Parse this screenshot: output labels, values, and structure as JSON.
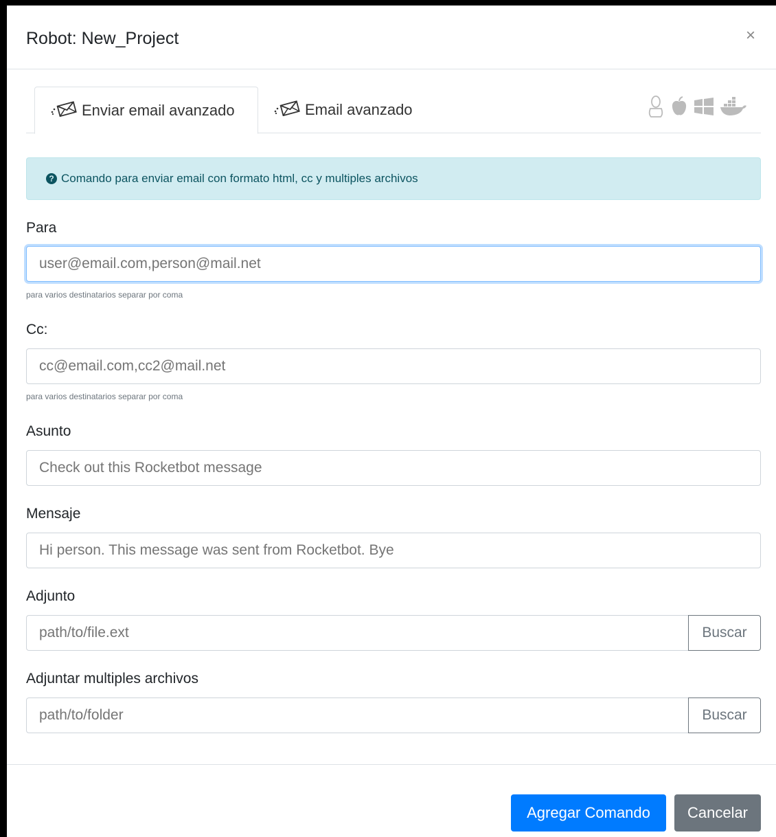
{
  "header": {
    "title": "Robot: New_Project",
    "close_symbol": "×"
  },
  "tabs": [
    {
      "label": "Enviar email avanzado",
      "icon": "envelope-icon",
      "active": true
    },
    {
      "label": "Email avanzado",
      "icon": "envelope-icon",
      "active": false
    }
  ],
  "os_icons": [
    "linux-icon",
    "apple-icon",
    "windows-icon",
    "docker-icon"
  ],
  "alert": {
    "text": "Comando para enviar email con formato html, cc y multiples archivos"
  },
  "fields": {
    "para": {
      "label": "Para",
      "placeholder": "user@email.com,person@mail.net",
      "help": "para varios destinatarios separar por coma"
    },
    "cc": {
      "label": "Cc:",
      "placeholder": "cc@email.com,cc2@mail.net",
      "help": "para varios destinatarios separar por coma"
    },
    "asunto": {
      "label": "Asunto",
      "placeholder": "Check out this Rocketbot message"
    },
    "mensaje": {
      "label": "Mensaje",
      "placeholder": "Hi person. This message was sent from Rocketbot. Bye"
    },
    "adjunto": {
      "label": "Adjunto",
      "placeholder": "path/to/file.ext",
      "button": "Buscar"
    },
    "multiples": {
      "label": "Adjuntar multiples archivos",
      "placeholder": "path/to/folder",
      "button": "Buscar"
    }
  },
  "footer": {
    "primary": "Agregar Comando",
    "secondary": "Cancelar"
  },
  "colors": {
    "primary": "#007bff",
    "secondary": "#6c757d",
    "alert_bg": "#d1ecf1"
  }
}
